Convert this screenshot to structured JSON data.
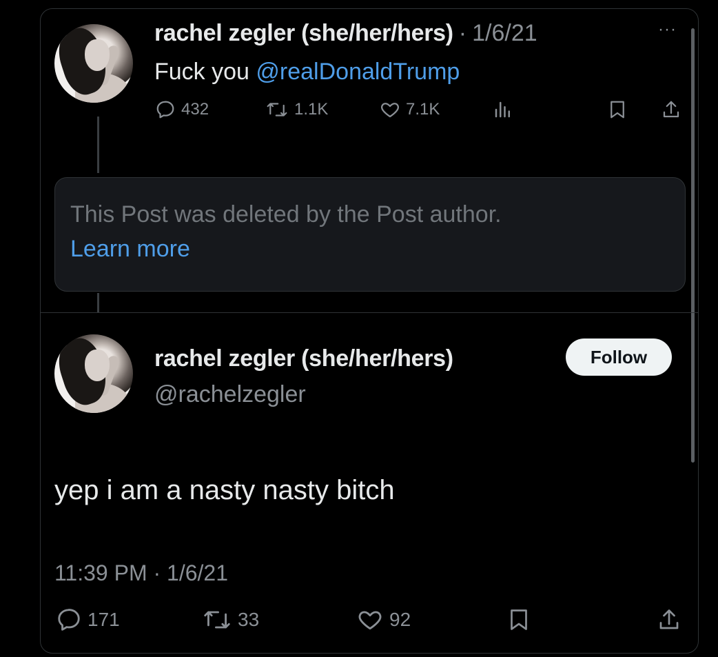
{
  "tweet1": {
    "display_name": "rachel zegler (she/her/hers)",
    "separator": "·",
    "date": "1/6/21",
    "more": "···",
    "text_prefix": "Fuck you ",
    "mention": "@realDonaldTrump",
    "replies": "432",
    "retweets": "1.1K",
    "likes": "7.1K"
  },
  "deleted_notice": {
    "text": "This Post was deleted by the Post author.",
    "link": "Learn more"
  },
  "tweet2": {
    "display_name": "rachel zegler (she/her/hers)",
    "handle": "@rachelzegler",
    "follow_label": "Follow",
    "text": "yep i am a nasty nasty bitch",
    "timestamp": "11:39 PM · 1/6/21",
    "replies": "171",
    "retweets": "33",
    "likes": "92"
  },
  "icons": [
    "reply-icon",
    "retweet-icon",
    "like-icon",
    "views-icon",
    "bookmark-icon",
    "share-icon",
    "more-icon"
  ],
  "colors": {
    "background": "#000000",
    "link": "#4f9ee9",
    "muted": "#8b9096",
    "text": "#e7e9ea",
    "follow_bg": "#eff3f4"
  }
}
